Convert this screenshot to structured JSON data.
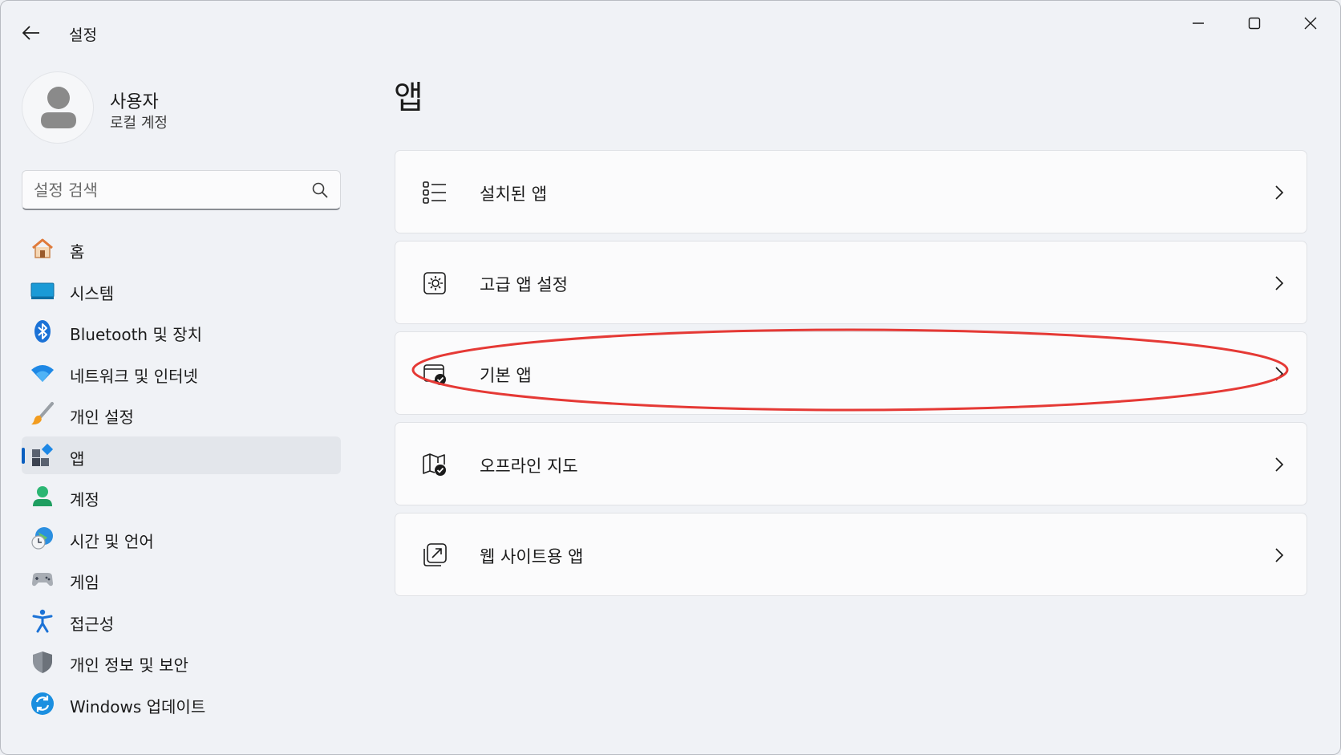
{
  "window": {
    "title": "설정"
  },
  "profile": {
    "name": "사용자",
    "account_type": "로컬 계정"
  },
  "search": {
    "placeholder": "설정 검색"
  },
  "nav": {
    "items": [
      {
        "label": "홈",
        "icon": "home-icon"
      },
      {
        "label": "시스템",
        "icon": "system-icon"
      },
      {
        "label": "Bluetooth 및 장치",
        "icon": "bluetooth-icon"
      },
      {
        "label": "네트워크 및 인터넷",
        "icon": "wifi-icon"
      },
      {
        "label": "개인 설정",
        "icon": "brush-icon"
      },
      {
        "label": "앱",
        "icon": "apps-icon",
        "selected": true
      },
      {
        "label": "계정",
        "icon": "account-icon"
      },
      {
        "label": "시간 및 언어",
        "icon": "time-language-icon"
      },
      {
        "label": "게임",
        "icon": "gamepad-icon"
      },
      {
        "label": "접근성",
        "icon": "accessibility-icon"
      },
      {
        "label": "개인 정보 및 보안",
        "icon": "shield-icon"
      },
      {
        "label": "Windows 업데이트",
        "icon": "update-icon"
      }
    ]
  },
  "main": {
    "title": "앱",
    "cards": [
      {
        "label": "설치된 앱",
        "icon": "installed-apps-icon"
      },
      {
        "label": "고급 앱 설정",
        "icon": "advanced-app-settings-icon"
      },
      {
        "label": "기본 앱",
        "icon": "default-apps-icon",
        "highlighted": true
      },
      {
        "label": "오프라인 지도",
        "icon": "offline-maps-icon"
      },
      {
        "label": "웹 사이트용 앱",
        "icon": "apps-for-websites-icon"
      }
    ]
  },
  "colors": {
    "accent": "#0a5fc0",
    "highlight_ellipse": "#e53935",
    "background": "#f0f2f6",
    "card": "#fbfbfc"
  }
}
